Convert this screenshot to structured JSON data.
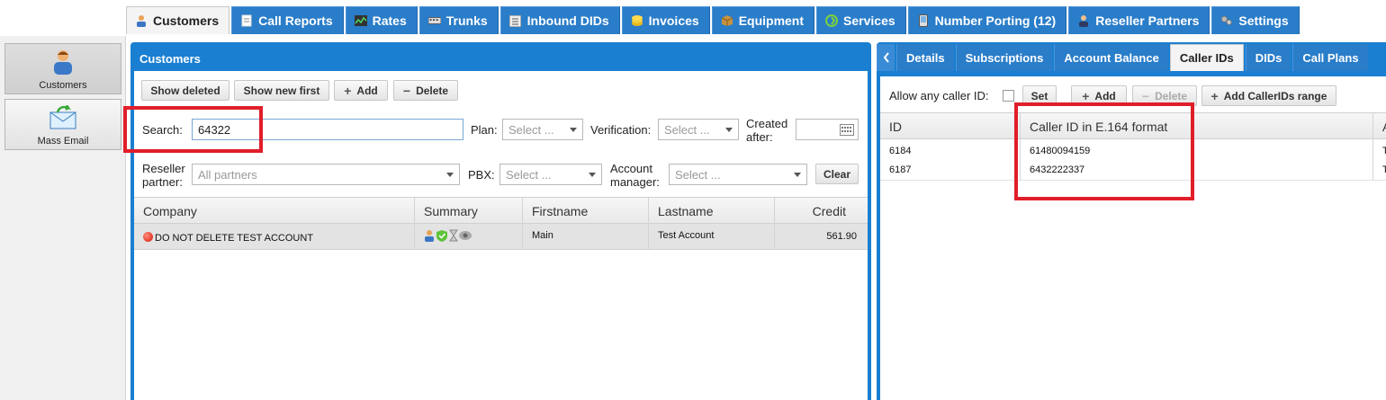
{
  "topnav": {
    "tabs": [
      {
        "label": "Customers",
        "icon": "user-icon"
      },
      {
        "label": "Call Reports",
        "icon": "document-icon"
      },
      {
        "label": "Rates",
        "icon": "chart-icon"
      },
      {
        "label": "Trunks",
        "icon": "trunk-icon"
      },
      {
        "label": "Inbound DIDs",
        "icon": "list-icon"
      },
      {
        "label": "Invoices",
        "icon": "coins-icon"
      },
      {
        "label": "Equipment",
        "icon": "box-icon"
      },
      {
        "label": "Services",
        "icon": "services-icon"
      },
      {
        "label": "Number Porting (12)",
        "icon": "phone-icon"
      },
      {
        "label": "Reseller Partners",
        "icon": "partner-icon"
      },
      {
        "label": "Settings",
        "icon": "gear-icon"
      }
    ]
  },
  "sidebar": {
    "items": [
      {
        "label": "Customers",
        "icon": "customer-icon"
      },
      {
        "label": "Mass Email",
        "icon": "email-icon"
      }
    ]
  },
  "customers": {
    "title": "Customers",
    "toolbar": {
      "show_deleted": "Show deleted",
      "show_new_first": "Show new first",
      "add": "Add",
      "delete": "Delete"
    },
    "filters": {
      "search_label": "Search:",
      "search_value": "64322",
      "plan_label": "Plan:",
      "plan_value": "Select ...",
      "verification_label": "Verification:",
      "verification_value": "Select ...",
      "created_label_1": "Created",
      "created_label_2": "after:",
      "reseller_label_1": "Reseller",
      "reseller_label_2": "partner:",
      "reseller_value": "All partners",
      "pbx_label": "PBX:",
      "pbx_value": "Select ...",
      "account_label_1": "Account",
      "account_label_2": "manager:",
      "account_value": "Select ...",
      "clear": "Clear"
    },
    "columns": [
      "Company",
      "Summary",
      "Firstname",
      "Lastname",
      "Credit"
    ],
    "rows": [
      {
        "company": "DO NOT DELETE TEST ACCOUNT",
        "firstname": "Main",
        "lastname": "Test Account",
        "credit": "561.90"
      }
    ]
  },
  "right": {
    "tabs": [
      "Details",
      "Subscriptions",
      "Account Balance",
      "Caller IDs",
      "DIDs",
      "Call Plans"
    ],
    "toolbar": {
      "allow_label": "Allow any caller ID:",
      "set": "Set",
      "add": "Add",
      "delete": "Delete",
      "add_range": "Add CallerIDs range"
    },
    "columns": [
      "ID",
      "Caller ID in E.164 format",
      "A"
    ],
    "rows": [
      {
        "id": "6184",
        "callerid": "61480094159",
        "extra": "Te"
      },
      {
        "id": "6187",
        "callerid": "6432222337",
        "extra": "Te"
      }
    ]
  },
  "colors": {
    "accent": "#1a7fd1",
    "highlight": "#e01e2a"
  }
}
